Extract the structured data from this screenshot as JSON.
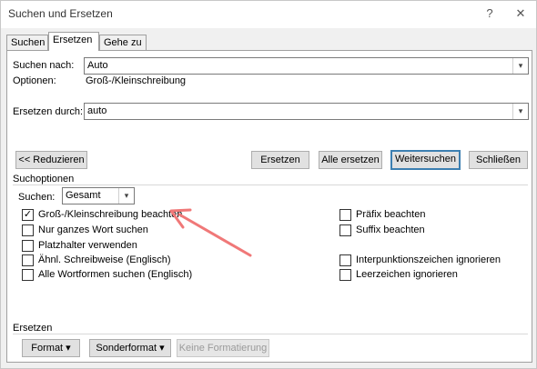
{
  "window": {
    "title": "Suchen und Ersetzen",
    "help_glyph": "?",
    "close_glyph": "✕"
  },
  "tabs": [
    {
      "label": "Suchen",
      "active": false
    },
    {
      "label": "Ersetzen",
      "active": true
    },
    {
      "label": "Gehe zu",
      "active": false
    }
  ],
  "search": {
    "label": "Suchen nach:",
    "value": "Auto",
    "options_label": "Optionen:",
    "options_value": "Groß-/Kleinschreibung"
  },
  "replace": {
    "label": "Ersetzen durch:",
    "value": "auto"
  },
  "buttons": {
    "reduce": "<< Reduzieren",
    "replace": "Ersetzen",
    "replace_all": "Alle ersetzen",
    "find_next": "Weitersuchen",
    "close": "Schließen"
  },
  "options": {
    "heading": "Suchoptionen",
    "direction_label": "Suchen:",
    "direction_value": "Gesamt",
    "left": [
      {
        "label": "Groß-/Kleinschreibung beachten",
        "checked": true
      },
      {
        "label": "Nur ganzes Wort suchen",
        "checked": false
      },
      {
        "label": "Platzhalter verwenden",
        "checked": false
      },
      {
        "label": "Ähnl. Schreibweise (Englisch)",
        "checked": false
      },
      {
        "label": "Alle Wortformen suchen (Englisch)",
        "checked": false
      }
    ],
    "right": [
      {
        "label": "Präfix beachten",
        "checked": false
      },
      {
        "label": "Suffix beachten",
        "checked": false
      },
      {
        "label": "Interpunktionszeichen ignorieren",
        "checked": false
      },
      {
        "label": "Leerzeichen ignorieren",
        "checked": false
      }
    ]
  },
  "format_section": {
    "heading": "Ersetzen",
    "format_button": "Format ▾",
    "special_button": "Sonderformat ▾",
    "no_format_button": "Keine Formatierung"
  },
  "annotation": {
    "arrow_color": "#f07878"
  },
  "icons": {
    "dropdown": "▾",
    "check": "✓"
  }
}
